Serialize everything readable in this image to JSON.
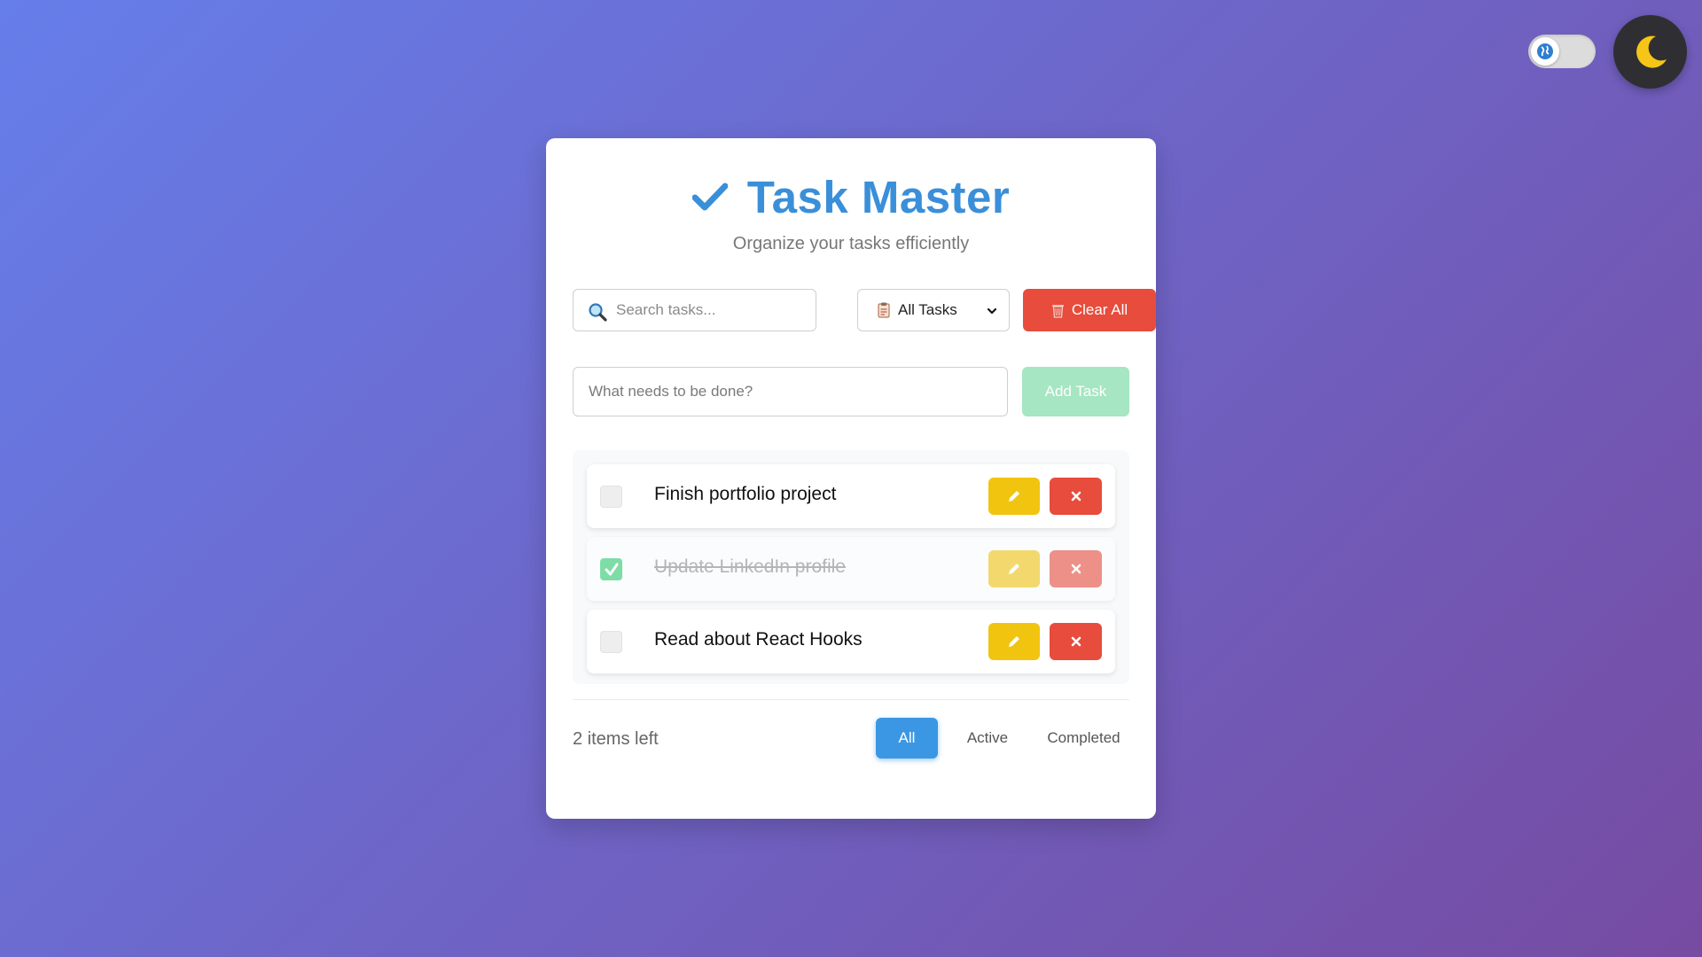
{
  "top_controls": {
    "toggle_icon": "globe-icon",
    "theme_icon": "moon-icon",
    "colors": {
      "moon": "#f5c518",
      "theme_bg": "#2f2f33"
    }
  },
  "header": {
    "icon": "checkmark-icon",
    "title": "Task Master",
    "subtitle": "Organize your tasks efficiently"
  },
  "toolbar": {
    "search_placeholder": "Search tasks...",
    "search_icon": "search-icon",
    "filter_select": {
      "value": "All Tasks",
      "icon": "clipboard-icon"
    },
    "clear_label": "Clear All",
    "clear_icon": "trash-icon"
  },
  "add_task": {
    "placeholder": "What needs to be done?",
    "button_label": "Add Task"
  },
  "tasks": [
    {
      "text": "Finish portfolio project",
      "completed": false
    },
    {
      "text": "Update LinkedIn profile",
      "completed": true
    },
    {
      "text": "Read about React Hooks",
      "completed": false
    }
  ],
  "footer": {
    "items_left": "2 items left",
    "filters": [
      {
        "label": "All",
        "active": true
      },
      {
        "label": "Active",
        "active": false
      },
      {
        "label": "Completed",
        "active": false
      }
    ]
  },
  "colors": {
    "accent": "#3a8fd9",
    "danger": "#e74c3c",
    "edit": "#f1c40f",
    "success": "#2ecc71",
    "add_button": "#a6e6c2",
    "bg_gradient": [
      "#667eea",
      "#764ba2"
    ]
  }
}
